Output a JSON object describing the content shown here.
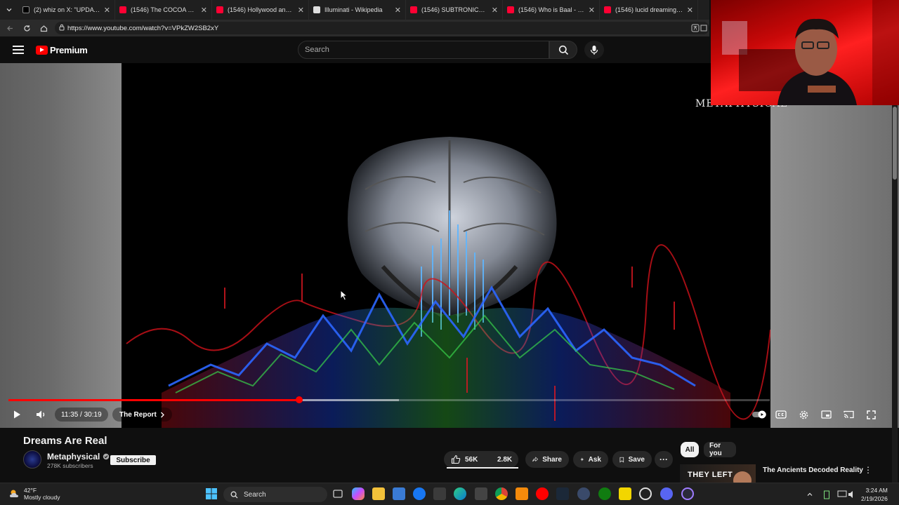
{
  "browser": {
    "tabs": [
      {
        "title": "(2) whiz on X: \"UPDATE: @k",
        "color": "#e8e8e8"
      },
      {
        "title": "(1546) The COCOA PUFFS C",
        "color": "#ff0033"
      },
      {
        "title": "(1546) Hollywood and the O",
        "color": "#ff0033"
      },
      {
        "title": "Illuminati - Wikipedia",
        "color": "#cccccc"
      },
      {
        "title": "(1546) SUBTRONICS LIVE @",
        "color": "#ff0033"
      },
      {
        "title": "(1546) Who is Baal - How a",
        "color": "#ff0033"
      },
      {
        "title": "(1546) lucid dreaming - You",
        "color": "#ff0033"
      }
    ],
    "url": "https://www.youtube.com/watch?v=VPkZW2SB2xY"
  },
  "masthead": {
    "logo_text": "Premium",
    "search_placeholder": "Search"
  },
  "player": {
    "brand_watermark": "METAPHYSICAL",
    "time_display": "11:35 / 30:19",
    "current_time": "11:35",
    "duration": "30:19",
    "progress_fraction": 0.3817,
    "chapter": "The Report"
  },
  "video": {
    "title": "Dreams Are Real",
    "channel": "Metaphysical",
    "subscribers": "278K subscribers",
    "subscribe_label": "Subscribe",
    "likes": "56K",
    "dislikes": "2.8K",
    "share_label": "Share",
    "ask_label": "Ask",
    "save_label": "Save"
  },
  "recommendations": {
    "chips": [
      "All",
      "For you"
    ],
    "first": {
      "thumb_text": "THEY LEFT",
      "title": "The Ancients Decoded Reality"
    }
  },
  "taskbar": {
    "weather_temp": "42°F",
    "weather_desc": "Mostly cloudy",
    "search_label": "Search",
    "time": "3:24 AM",
    "date": "2/19/2026"
  }
}
